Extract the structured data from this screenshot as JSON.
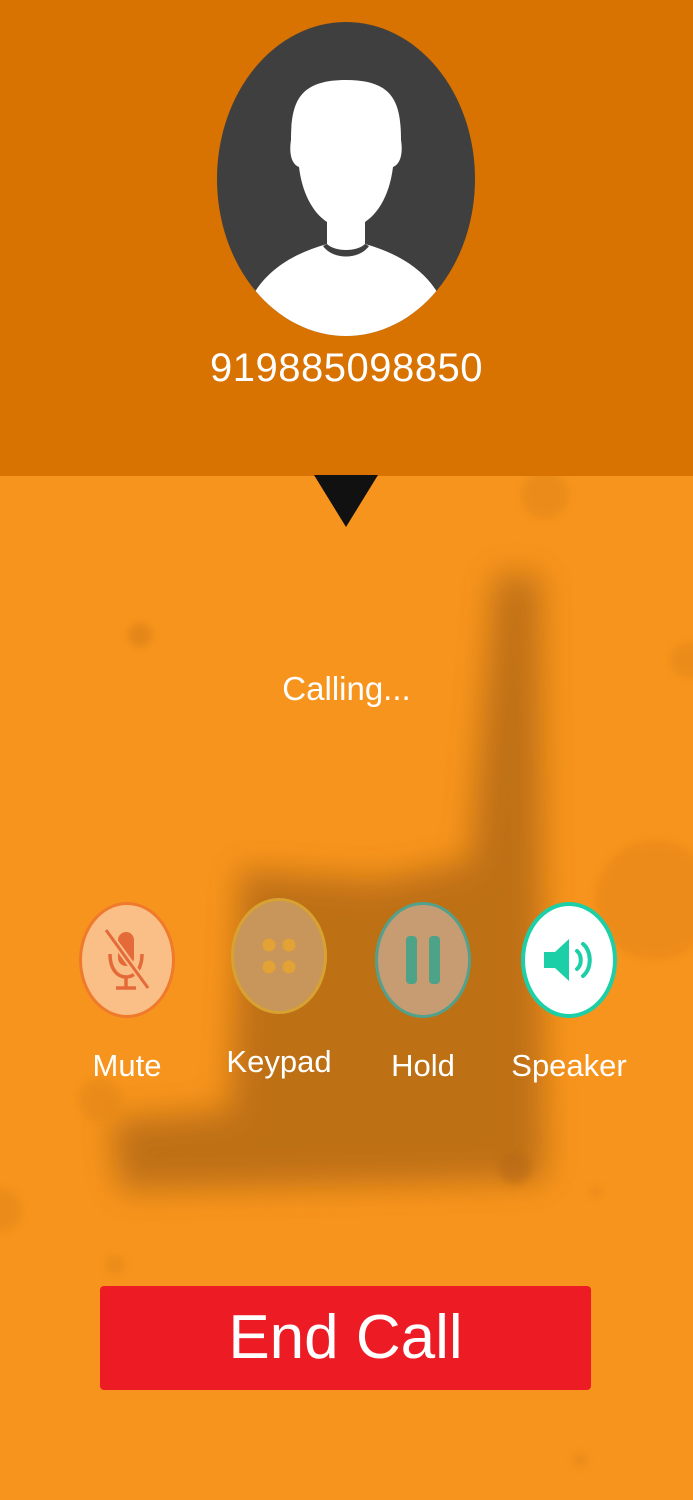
{
  "caller": {
    "number": "919885098850",
    "avatar_icon": "person-silhouette-icon"
  },
  "call": {
    "status": "Calling..."
  },
  "controls": [
    {
      "id": "mute",
      "label": "Mute",
      "icon": "microphone-off-icon",
      "active": false
    },
    {
      "id": "keypad",
      "label": "Keypad",
      "icon": "dial-pad-icon",
      "active": false
    },
    {
      "id": "hold",
      "label": "Hold",
      "icon": "pause-icon",
      "active": false
    },
    {
      "id": "speaker",
      "label": "Speaker",
      "icon": "speaker-icon",
      "active": true
    }
  ],
  "end_call": {
    "label": "End Call"
  },
  "colors": {
    "header": "#d87200",
    "background": "#f7941d",
    "end_call": "#ed1c24",
    "speaker_accent": "#1ccfa6"
  }
}
